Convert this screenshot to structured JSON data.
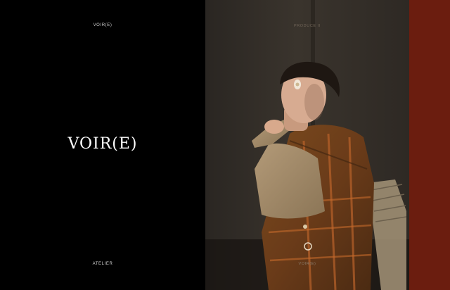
{
  "brand": {
    "title": "VOIR(E)"
  },
  "left_panel": {
    "top_link": "VOIR(E)",
    "bottom_link": "ATELIER"
  },
  "photo_panel": {
    "top_label": "PRODUCE II",
    "bottom_label": "VOIR(E)"
  },
  "colors": {
    "left_bg": "#000000",
    "accent_strip": "#6b1d0f",
    "photo_wall": "#2e2a25"
  }
}
